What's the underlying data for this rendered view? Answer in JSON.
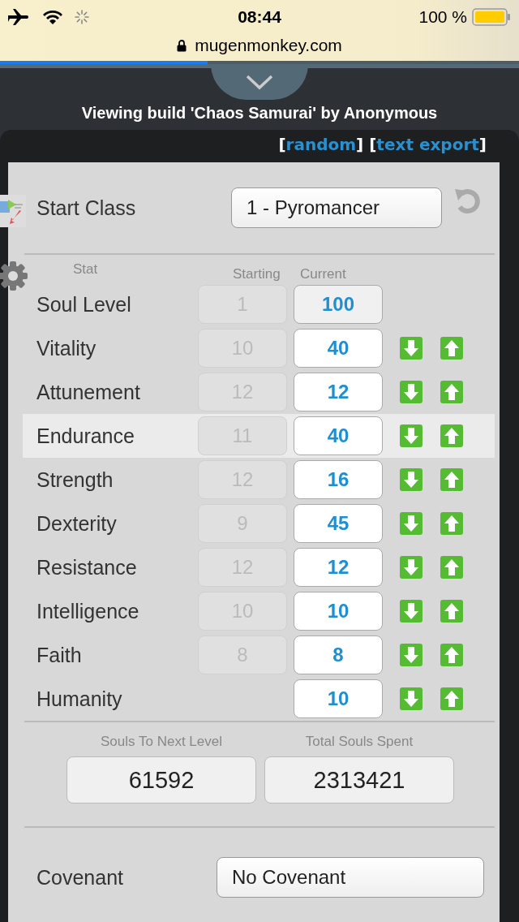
{
  "status_bar": {
    "time": "08:44",
    "battery": "100 %"
  },
  "browser": {
    "url": "mugenmonkey.com",
    "progress": {
      "level": 0.4
    }
  },
  "title": "Viewing build 'Chaos Samurai' by Anonymous",
  "links": [
    {
      "open": "[",
      "label": "random",
      "close": "]"
    },
    {
      "open": "[",
      "label": "text export",
      "close": "]"
    }
  ],
  "start_class": {
    "label": "Start Class",
    "value": "1 - Pyromancer"
  },
  "stat_headers": {
    "stat": "Stat",
    "starting": "Starting",
    "current": "Current"
  },
  "stats": [
    {
      "kind": "level",
      "name": "Soul Level",
      "starting": "1",
      "current": "100",
      "selected": false
    },
    {
      "kind": "stat",
      "name": "Vitality",
      "starting": "10",
      "current": "40",
      "selected": false
    },
    {
      "kind": "stat",
      "name": "Attunement",
      "starting": "12",
      "current": "12",
      "selected": false
    },
    {
      "kind": "stat",
      "name": "Endurance",
      "starting": "11",
      "current": "40",
      "selected": true
    },
    {
      "kind": "stat",
      "name": "Strength",
      "starting": "12",
      "current": "16",
      "selected": false
    },
    {
      "kind": "stat",
      "name": "Dexterity",
      "starting": "9",
      "current": "45",
      "selected": false
    },
    {
      "kind": "stat",
      "name": "Resistance",
      "starting": "12",
      "current": "12",
      "selected": false
    },
    {
      "kind": "stat",
      "name": "Intelligence",
      "starting": "10",
      "current": "10",
      "selected": false
    },
    {
      "kind": "stat",
      "name": "Faith",
      "starting": "8",
      "current": "8",
      "selected": false
    },
    {
      "kind": "stat",
      "name": "Humanity",
      "current": "10",
      "selected": false
    }
  ],
  "souls": [
    {
      "label": "Souls To Next Level",
      "value": "61592"
    },
    {
      "label": "Total Souls Spent",
      "value": "2313421"
    }
  ],
  "covenant": {
    "label": "Covenant",
    "value": "No Covenant"
  }
}
